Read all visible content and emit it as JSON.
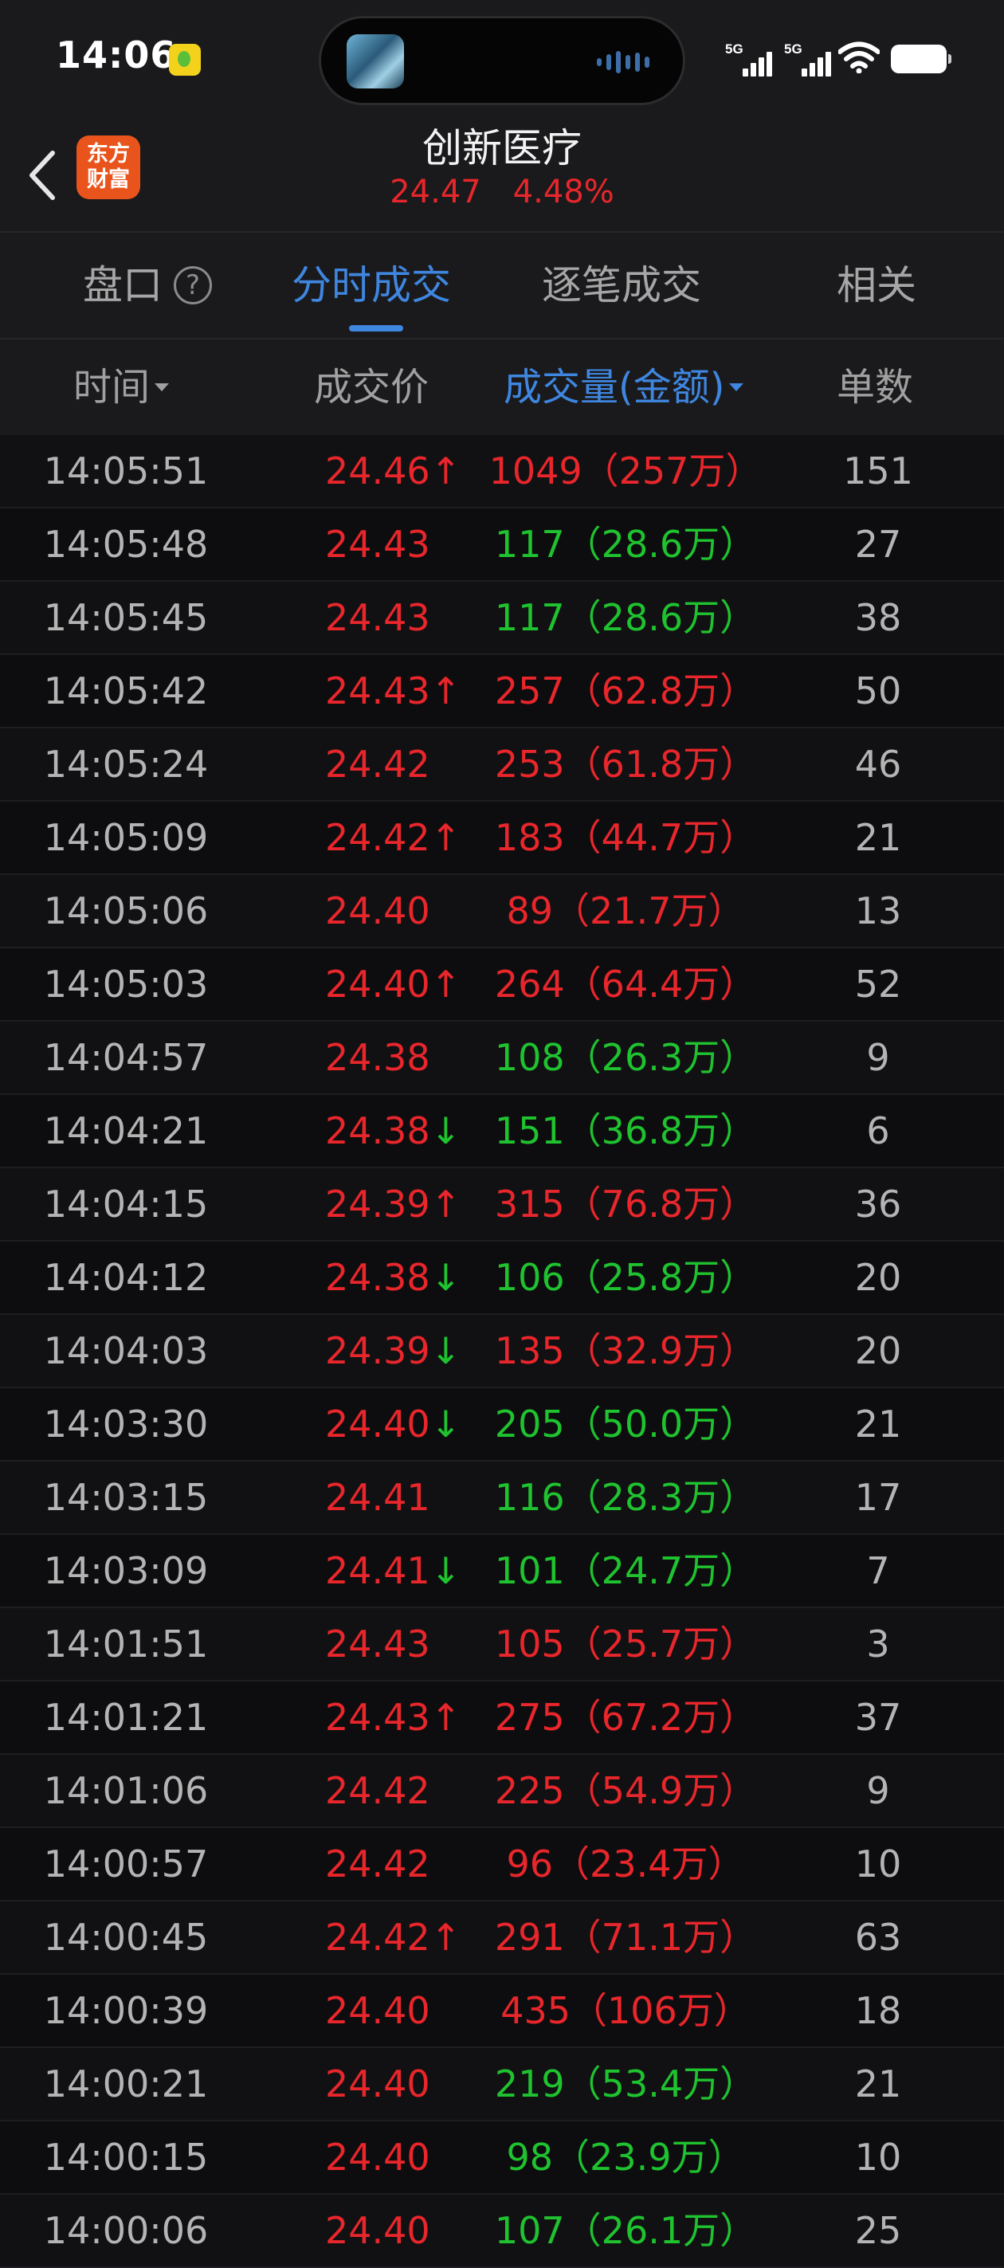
{
  "status_bar": {
    "time": "14:06",
    "network1": "5G",
    "network2": "5G"
  },
  "header": {
    "brand_logo_text": "东方财富",
    "stock_name": "创新医疗",
    "price": "24.47",
    "change_pct": "4.48%"
  },
  "tabs": [
    {
      "label": "盘口",
      "active": false
    },
    {
      "label": "分时成交",
      "active": true
    },
    {
      "label": "逐笔成交",
      "active": false
    },
    {
      "label": "相关",
      "active": false
    }
  ],
  "help_icon": "?",
  "columns": {
    "time": "时间",
    "price": "成交价",
    "volume": "成交量(金额)",
    "count": "单数"
  },
  "colors": {
    "up": "#e8262b",
    "down": "#1fc22f",
    "accent": "#3f86e0"
  },
  "arrow_glyphs": {
    "up": "↑",
    "down": "↓"
  },
  "rows": [
    {
      "time": "14:05:51",
      "price": "24.46",
      "dir": "up",
      "volume": "1049（257万）",
      "vol_color": "red",
      "count": "151"
    },
    {
      "time": "14:05:48",
      "price": "24.43",
      "dir": "",
      "volume": "117（28.6万）",
      "vol_color": "green",
      "count": "27"
    },
    {
      "time": "14:05:45",
      "price": "24.43",
      "dir": "",
      "volume": "117（28.6万）",
      "vol_color": "green",
      "count": "38"
    },
    {
      "time": "14:05:42",
      "price": "24.43",
      "dir": "up",
      "volume": "257（62.8万）",
      "vol_color": "red",
      "count": "50"
    },
    {
      "time": "14:05:24",
      "price": "24.42",
      "dir": "",
      "volume": "253（61.8万）",
      "vol_color": "red",
      "count": "46"
    },
    {
      "time": "14:05:09",
      "price": "24.42",
      "dir": "up",
      "volume": "183（44.7万）",
      "vol_color": "red",
      "count": "21"
    },
    {
      "time": "14:05:06",
      "price": "24.40",
      "dir": "",
      "volume": "89（21.7万）",
      "vol_color": "red",
      "count": "13"
    },
    {
      "time": "14:05:03",
      "price": "24.40",
      "dir": "up",
      "volume": "264（64.4万）",
      "vol_color": "red",
      "count": "52"
    },
    {
      "time": "14:04:57",
      "price": "24.38",
      "dir": "",
      "volume": "108（26.3万）",
      "vol_color": "green",
      "count": "9"
    },
    {
      "time": "14:04:21",
      "price": "24.38",
      "dir": "down",
      "volume": "151（36.8万）",
      "vol_color": "green",
      "count": "6"
    },
    {
      "time": "14:04:15",
      "price": "24.39",
      "dir": "up",
      "volume": "315（76.8万）",
      "vol_color": "red",
      "count": "36"
    },
    {
      "time": "14:04:12",
      "price": "24.38",
      "dir": "down",
      "volume": "106（25.8万）",
      "vol_color": "green",
      "count": "20"
    },
    {
      "time": "14:04:03",
      "price": "24.39",
      "dir": "down",
      "volume": "135（32.9万）",
      "vol_color": "red",
      "count": "20"
    },
    {
      "time": "14:03:30",
      "price": "24.40",
      "dir": "down",
      "volume": "205（50.0万）",
      "vol_color": "green",
      "count": "21"
    },
    {
      "time": "14:03:15",
      "price": "24.41",
      "dir": "",
      "volume": "116（28.3万）",
      "vol_color": "green",
      "count": "17"
    },
    {
      "time": "14:03:09",
      "price": "24.41",
      "dir": "down",
      "volume": "101（24.7万）",
      "vol_color": "green",
      "count": "7"
    },
    {
      "time": "14:01:51",
      "price": "24.43",
      "dir": "",
      "volume": "105（25.7万）",
      "vol_color": "red",
      "count": "3"
    },
    {
      "time": "14:01:21",
      "price": "24.43",
      "dir": "up",
      "volume": "275（67.2万）",
      "vol_color": "red",
      "count": "37"
    },
    {
      "time": "14:01:06",
      "price": "24.42",
      "dir": "",
      "volume": "225（54.9万）",
      "vol_color": "red",
      "count": "9"
    },
    {
      "time": "14:00:57",
      "price": "24.42",
      "dir": "",
      "volume": "96（23.4万）",
      "vol_color": "red",
      "count": "10"
    },
    {
      "time": "14:00:45",
      "price": "24.42",
      "dir": "up",
      "volume": "291（71.1万）",
      "vol_color": "red",
      "count": "63"
    },
    {
      "time": "14:00:39",
      "price": "24.40",
      "dir": "",
      "volume": "435（106万）",
      "vol_color": "red",
      "count": "18"
    },
    {
      "time": "14:00:21",
      "price": "24.40",
      "dir": "",
      "volume": "219（53.4万）",
      "vol_color": "green",
      "count": "21"
    },
    {
      "time": "14:00:15",
      "price": "24.40",
      "dir": "",
      "volume": "98（23.9万）",
      "vol_color": "green",
      "count": "10"
    },
    {
      "time": "14:00:06",
      "price": "24.40",
      "dir": "",
      "volume": "107（26.1万）",
      "vol_color": "green",
      "count": "25"
    }
  ]
}
